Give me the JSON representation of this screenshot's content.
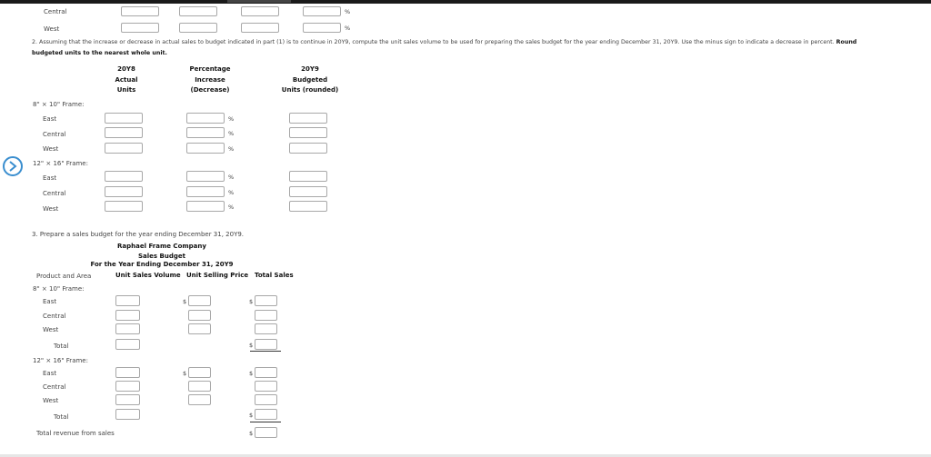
{
  "q1_partial": {
    "rows": [
      {
        "label": "Central",
        "pct": "%"
      },
      {
        "label": "West",
        "pct": "%"
      }
    ]
  },
  "q2": {
    "instruction_line1": "2.  Assuming that the increase or decrease in actual sales to budget indicated in part (1) is to continue in 20Y9, compute the unit sales volume to be used for preparing the sales budget for the year ending December 31, 20Y9. Use the minus sign to indicate a decrease in percent.",
    "instruction_round": "Round",
    "instruction_line2": "budgeted units to the nearest whole unit.",
    "col_actual": [
      "20Y8",
      "Actual",
      "Units"
    ],
    "col_pct": [
      "Percentage",
      "Increase",
      "(Decrease)"
    ],
    "col_budget": [
      "20Y9",
      "Budgeted",
      "Units (rounded)"
    ],
    "group1": {
      "label": "8\" × 10\" Frame:",
      "rows": [
        "East",
        "Central",
        "West"
      ]
    },
    "group2": {
      "label": "12\" × 16\" Frame:",
      "rows": [
        "East",
        "Central",
        "West"
      ]
    },
    "pct_symbol": "%"
  },
  "q3": {
    "instruction": "3.  Prepare a sales budget for the year ending December 31, 20Y9.",
    "company": "Raphael Frame Company",
    "report": "Sales Budget",
    "period": "For the Year Ending December 31, 20Y9",
    "col_product": "Product and Area",
    "col_volume": "Unit Sales Volume",
    "col_price": "Unit Selling Price",
    "col_total": "Total Sales",
    "group1": {
      "label": "8\" × 10\" Frame:",
      "rows": [
        "East",
        "Central",
        "West"
      ],
      "total": "Total"
    },
    "group2": {
      "label": "12\" × 16\" Frame:",
      "rows": [
        "East",
        "Central",
        "West"
      ],
      "total": "Total"
    },
    "revenue_label": "Total revenue from sales",
    "dollar": "$"
  }
}
